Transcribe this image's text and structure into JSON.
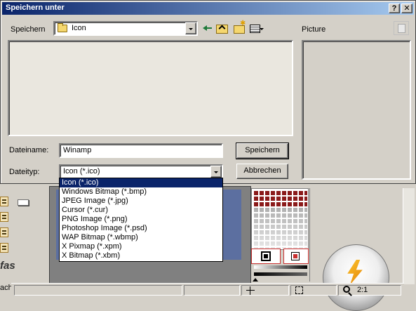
{
  "dialog": {
    "title": "Speichern unter",
    "help_label": "?",
    "close_label": "✕",
    "save_in_label": "Speichern",
    "folder_name": "Icon",
    "picture_label": "Picture",
    "filename_label": "Dateiname:",
    "filename_value": "Winamp",
    "filetype_label": "Dateityp:",
    "filetype_value": "Icon (*.ico)",
    "save_button": "Speichern",
    "cancel_button": "Abbrechen"
  },
  "filetype_options": [
    "Icon (*.ico)",
    "Windows Bitmap (*.bmp)",
    "JPEG Image (*.jpg)",
    "Cursor (*.cur)",
    "PNG Image (*.png)",
    "Photoshop Image (*.psd)",
    "WAP Bitmap (*.wbmp)",
    "X Pixmap (*.xpm)",
    "X Bitmap (*.xbm)"
  ],
  "background_app": {
    "partial_text_fas": "fas",
    "partial_text_ach": "ach",
    "zoom_level": "2:1"
  },
  "colors": {
    "titlebar_start": "#0a246a",
    "titlebar_end": "#a6caf0",
    "selection": "#0a246a",
    "face": "#d4d0c8"
  }
}
